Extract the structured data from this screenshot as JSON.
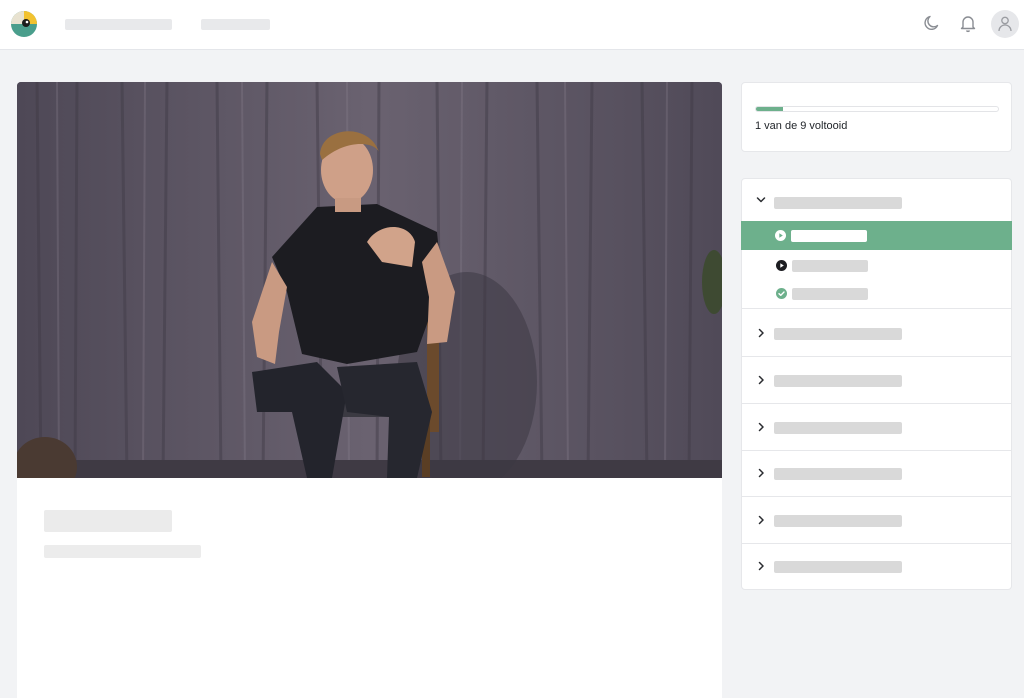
{
  "header": {
    "logo_icon": "brand-logo",
    "nav_placeholders": 2,
    "icons": [
      "moon-icon",
      "bell-icon",
      "user-icon"
    ]
  },
  "progress": {
    "completed": 1,
    "total": 9,
    "fraction": 0.111,
    "label": "1 van de 9 voltooid",
    "fill_color": "#6db08c"
  },
  "chapters": {
    "open_chapter": {
      "expanded": true,
      "lessons": [
        {
          "status": "playing",
          "active": true,
          "icon": "play-circle-icon"
        },
        {
          "status": "not-started",
          "active": false,
          "icon": "play-circle-icon"
        },
        {
          "status": "completed",
          "active": false,
          "icon": "check-circle-icon"
        }
      ]
    },
    "collapsed_count": 6
  },
  "colors": {
    "accent": "#6db08c",
    "placeholder": "#d9d9d9",
    "background": "#f2f3f5"
  }
}
